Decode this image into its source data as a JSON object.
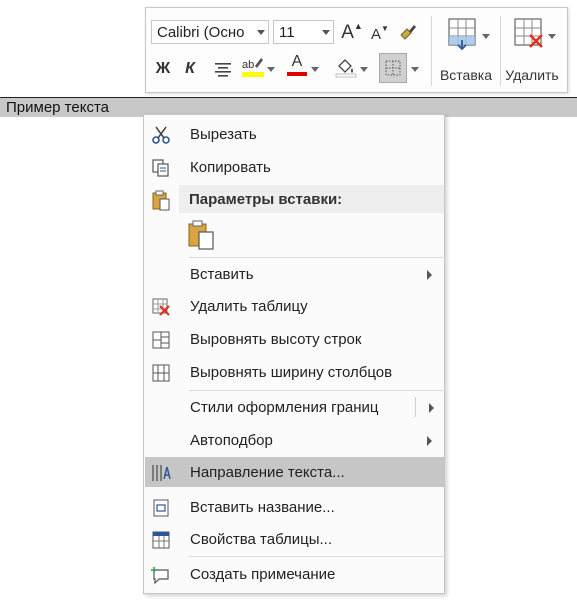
{
  "document": {
    "text": "Пример текста"
  },
  "mini_toolbar": {
    "font_name": "Calibri (Осно",
    "font_size": "11",
    "grow_font": "A",
    "shrink_font": "A",
    "bold": "Ж",
    "italic": "К",
    "font_color_letter": "A",
    "insert_label": "Вставка",
    "delete_label": "Удалить",
    "highlight_color": "#ffff00",
    "font_color": "#e00000"
  },
  "context_menu": {
    "cut": "Вырезать",
    "copy": "Копировать",
    "paste_options": "Параметры вставки:",
    "insert": "Вставить",
    "delete_table": "Удалить таблицу",
    "distribute_rows": "Выровнять высоту строк",
    "distribute_cols": "Выровнять ширину столбцов",
    "border_styles": "Стили оформления границ",
    "autofit": "Автоподбор",
    "text_direction": "Направление текста...",
    "insert_caption": "Вставить название...",
    "table_properties": "Свойства таблицы...",
    "new_comment": "Создать примечание"
  },
  "colors": {
    "highlight": "#c6c6c6",
    "accent_red": "#e03020",
    "icon_blue": "#2b579a"
  }
}
